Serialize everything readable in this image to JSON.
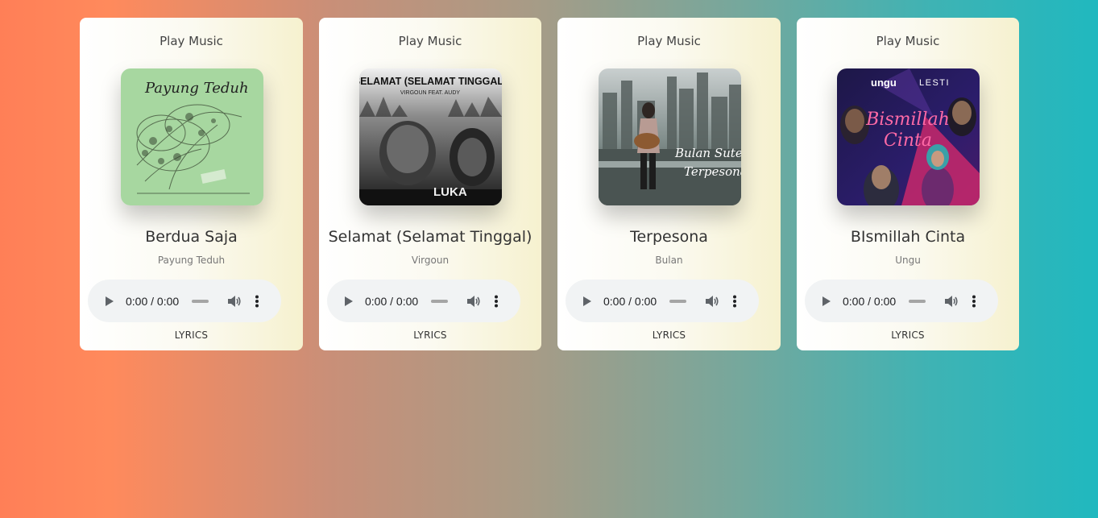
{
  "cards": [
    {
      "heading": "Play Music",
      "title": "Berdua Saja",
      "artist": "Payung Teduh",
      "time": "0:00 / 0:00",
      "lyrics": "LYRICS",
      "cover_text": "Payung Teduh",
      "cover_color": "#a7d7a0"
    },
    {
      "heading": "Play Music",
      "title": "Selamat (Selamat Tinggal)",
      "artist": "Virgoun",
      "time": "0:00 / 0:00",
      "lyrics": "LYRICS",
      "cover_text": "SELAMAT (SELAMAT TINGGAL)",
      "cover_sub": "VIRGOUN FEAT. AUDY",
      "cover_badge": "LUKA",
      "cover_color": "#3a3a3a"
    },
    {
      "heading": "Play Music",
      "title": "Terpesona",
      "artist": "Bulan",
      "time": "0:00 / 0:00",
      "lyrics": "LYRICS",
      "cover_text": "Bulan Sutena",
      "cover_sub": "Terpesona",
      "cover_color": "#6b7a78"
    },
    {
      "heading": "Play Music",
      "title": "BIsmillah Cinta",
      "artist": "Ungu",
      "time": "0:00 / 0:00",
      "lyrics": "LYRICS",
      "cover_text": "Bismillah",
      "cover_sub": "Cinta",
      "cover_top_left": "ungu",
      "cover_top_right": "LESTI",
      "cover_color": "#241a5c"
    }
  ],
  "icons": {
    "play": "play-icon",
    "volume": "volume-icon",
    "menu": "more-vertical-icon"
  }
}
